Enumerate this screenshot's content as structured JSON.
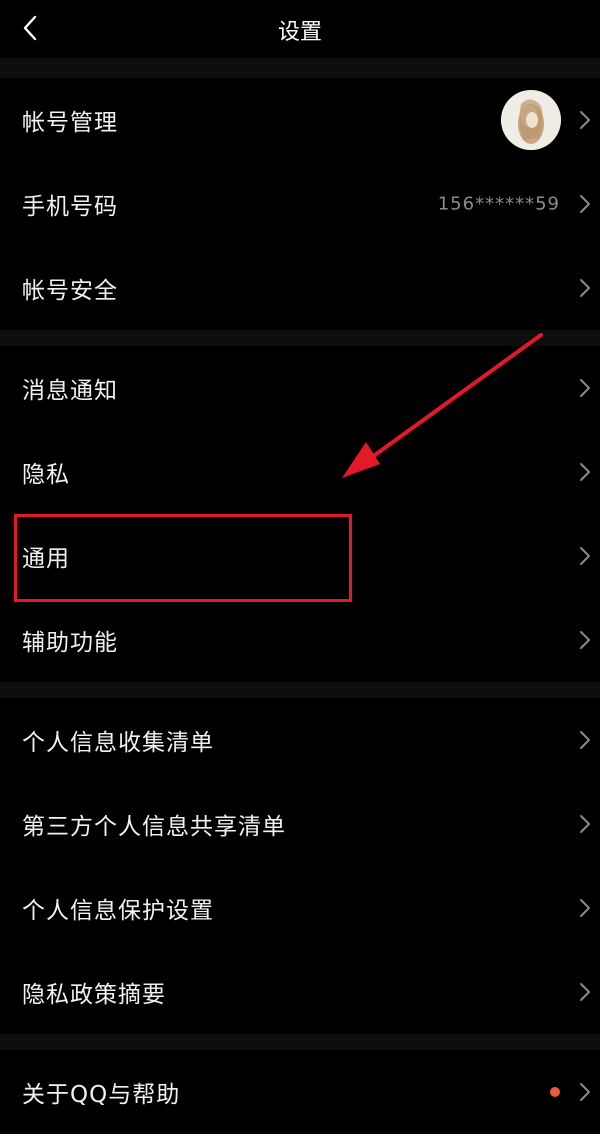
{
  "header": {
    "title": "设置",
    "back_icon": "chevron-left-icon"
  },
  "accent": {
    "annotation_red": "#e3192a",
    "badge_red": "#f05a3c"
  },
  "groups": [
    {
      "items": [
        {
          "label": "帐号管理",
          "value": "",
          "trailing": "avatar"
        },
        {
          "label": "手机号码",
          "value": "156******59",
          "trailing": "value"
        },
        {
          "label": "帐号安全",
          "value": "",
          "trailing": ""
        }
      ]
    },
    {
      "items": [
        {
          "label": "消息通知",
          "value": "",
          "trailing": ""
        },
        {
          "label": "隐私",
          "value": "",
          "trailing": ""
        },
        {
          "label": "通用",
          "value": "",
          "trailing": "",
          "highlighted": true
        },
        {
          "label": "辅助功能",
          "value": "",
          "trailing": ""
        }
      ]
    },
    {
      "items": [
        {
          "label": "个人信息收集清单",
          "value": "",
          "trailing": ""
        },
        {
          "label": "第三方个人信息共享清单",
          "value": "",
          "trailing": ""
        },
        {
          "label": "个人信息保护设置",
          "value": "",
          "trailing": ""
        },
        {
          "label": "隐私政策摘要",
          "value": "",
          "trailing": ""
        }
      ]
    },
    {
      "items": [
        {
          "label": "关于QQ与帮助",
          "value": "",
          "trailing": "badge"
        }
      ]
    }
  ],
  "icons": {
    "row_chevron": "chevron-right-icon",
    "annotation": "red-arrow-annotation"
  }
}
